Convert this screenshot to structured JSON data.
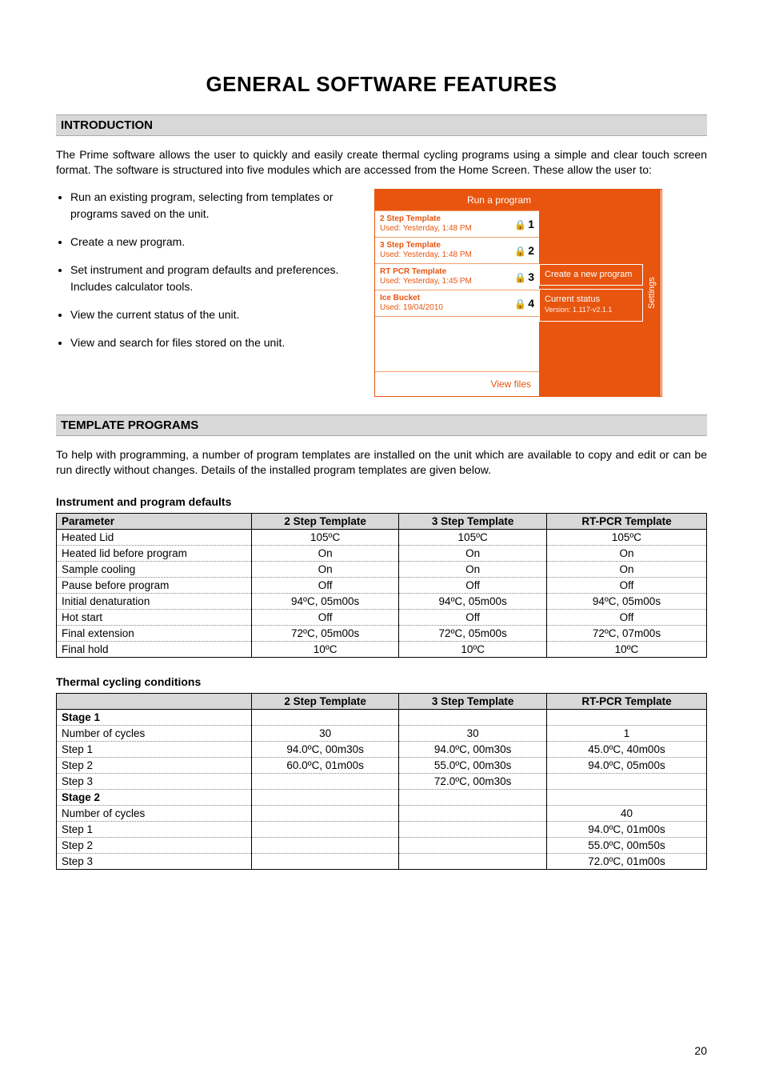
{
  "page": {
    "number": "20",
    "title": "GENERAL SOFTWARE FEATURES"
  },
  "intro": {
    "heading": "INTRODUCTION",
    "text": "The Prime software allows the user to quickly and easily create thermal cycling programs using a simple and clear touch screen format. The software is structured into five modules which are accessed from the Home Screen. These allow the user to:",
    "bullets": [
      "Run an existing program, selecting from templates or programs saved on the unit.",
      "Create a new program.",
      "Set instrument and program defaults and preferences. Includes calculator tools.",
      "View the current status of the unit.",
      "View and search for files stored on the unit."
    ]
  },
  "device": {
    "run_header": "Run a program",
    "items": [
      {
        "name": "2 Step Template",
        "meta": "Used: Yesterday, 1:48 PM",
        "badge": "1"
      },
      {
        "name": "3 Step Template",
        "meta": "Used: Yesterday, 1:48 PM",
        "badge": "2"
      },
      {
        "name": "RT PCR Template",
        "meta": "Used: Yesterday, 1:45 PM",
        "badge": "3"
      },
      {
        "name": "Ice Bucket",
        "meta": "Used: 19/04/2010",
        "badge": "4"
      }
    ],
    "view_files": "View files",
    "create": "Create a new program",
    "status_title": "Current status",
    "status_ver": "Version: 1.117-v2.1.1",
    "settings": "Settings"
  },
  "templates": {
    "heading": "TEMPLATE PROGRAMS",
    "text": "To help with programming, a number of program templates are installed on the unit which are available to copy and edit or can be run directly without changes. Details of the installed program templates are given below.",
    "defaults_title": "Instrument and program defaults",
    "defaults": {
      "headers": [
        "Parameter",
        "2 Step Template",
        "3 Step Template",
        "RT-PCR Template"
      ],
      "rows": [
        [
          "Heated Lid",
          "105ºC",
          "105ºC",
          "105ºC"
        ],
        [
          "Heated lid before program",
          "On",
          "On",
          "On"
        ],
        [
          "Sample cooling",
          "On",
          "On",
          "On"
        ],
        [
          "Pause before program",
          "Off",
          "Off",
          "Off"
        ],
        [
          "Initial denaturation",
          "94ºC, 05m00s",
          "94ºC, 05m00s",
          "94ºC, 05m00s"
        ],
        [
          "Hot start",
          "Off",
          "Off",
          "Off"
        ],
        [
          "Final extension",
          "72ºC, 05m00s",
          "72ºC, 05m00s",
          "72ºC, 07m00s"
        ],
        [
          "Final hold",
          "10ºC",
          "10ºC",
          "10ºC"
        ]
      ]
    },
    "cycling_title": "Thermal cycling conditions",
    "cycling": {
      "headers": [
        "",
        "2 Step Template",
        "3 Step Template",
        "RT-PCR Template"
      ],
      "rows": [
        {
          "label": "Stage 1",
          "bold": true,
          "cells": [
            "",
            "",
            ""
          ]
        },
        {
          "label": "Number of cycles",
          "cells": [
            "30",
            "30",
            "1"
          ]
        },
        {
          "label": "Step 1",
          "cells": [
            "94.0ºC, 00m30s",
            "94.0ºC, 00m30s",
            "45.0ºC, 40m00s"
          ]
        },
        {
          "label": "Step 2",
          "cells": [
            "60.0ºC, 01m00s",
            "55.0ºC, 00m30s",
            "94.0ºC, 05m00s"
          ]
        },
        {
          "label": "Step 3",
          "cells": [
            "",
            "72.0ºC, 00m30s",
            ""
          ]
        },
        {
          "label": "Stage 2",
          "bold": true,
          "cells": [
            "",
            "",
            ""
          ]
        },
        {
          "label": "Number of cycles",
          "cells": [
            "",
            "",
            "40"
          ]
        },
        {
          "label": "Step 1",
          "cells": [
            "",
            "",
            "94.0ºC, 01m00s"
          ]
        },
        {
          "label": "Step 2",
          "cells": [
            "",
            "",
            "55.0ºC, 00m50s"
          ]
        },
        {
          "label": "Step 3",
          "cells": [
            "",
            "",
            "72.0ºC, 01m00s"
          ]
        }
      ]
    }
  }
}
